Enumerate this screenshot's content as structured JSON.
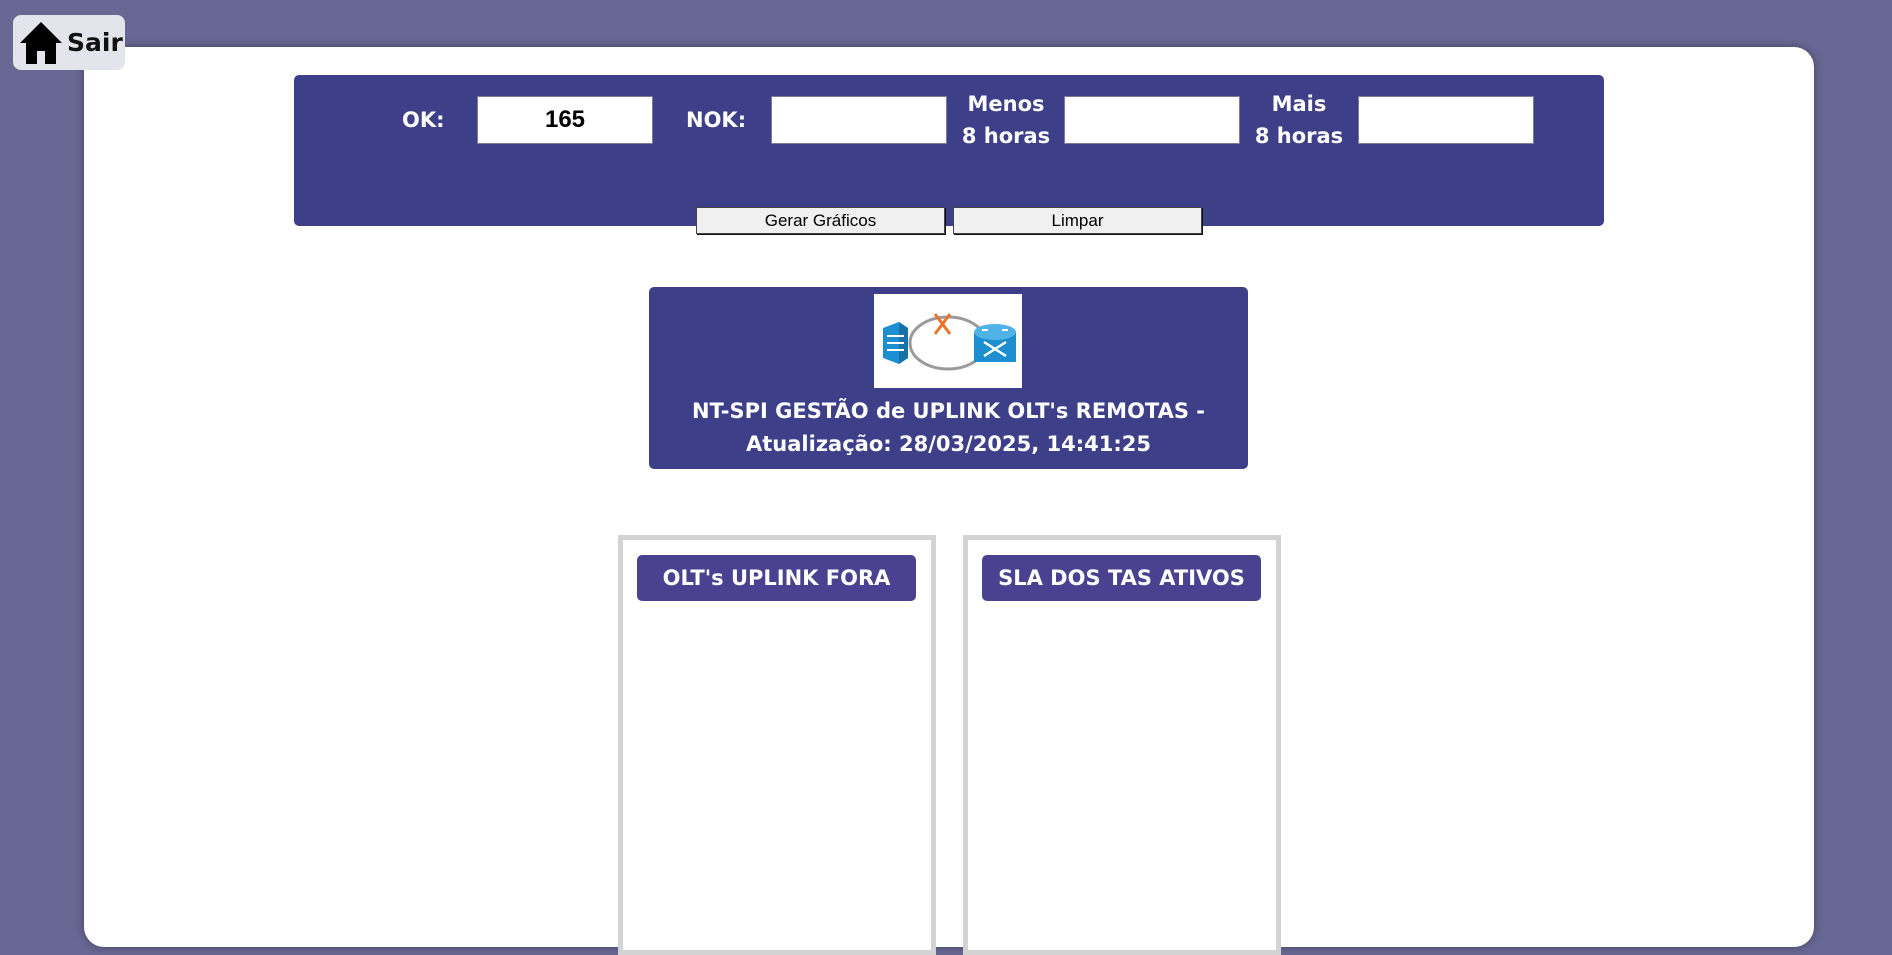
{
  "nav": {
    "exit_label": "Sair",
    "icon": "home-icon"
  },
  "filters": {
    "ok_label": "OK:",
    "ok_value": "165",
    "nok_label": "NOK:",
    "nok_value": "",
    "menos_label_1": "Menos",
    "menos_label_2": "8 horas",
    "menos_value": "",
    "mais_label_1": "Mais",
    "mais_label_2": "8 horas",
    "mais_value": "",
    "gerar_label": "Gerar Gráficos",
    "limpar_label": "Limpar"
  },
  "header": {
    "logo_icon": "olt-uplink-logo",
    "title_line1": "NT-SPI GESTÃO de UPLINK OLT's REMOTAS -",
    "title_line2": "Atualização: 28/03/2025, 14:41:25"
  },
  "panels": [
    {
      "title": "OLT's UPLINK FORA"
    },
    {
      "title": "SLA DOS TAS ATIVOS"
    }
  ],
  "colors": {
    "background": "#686894",
    "bar": "#3d4089",
    "panel_title": "#4a4190",
    "logo_orange": "#e8742a",
    "logo_blue": "#1d8fd0"
  }
}
